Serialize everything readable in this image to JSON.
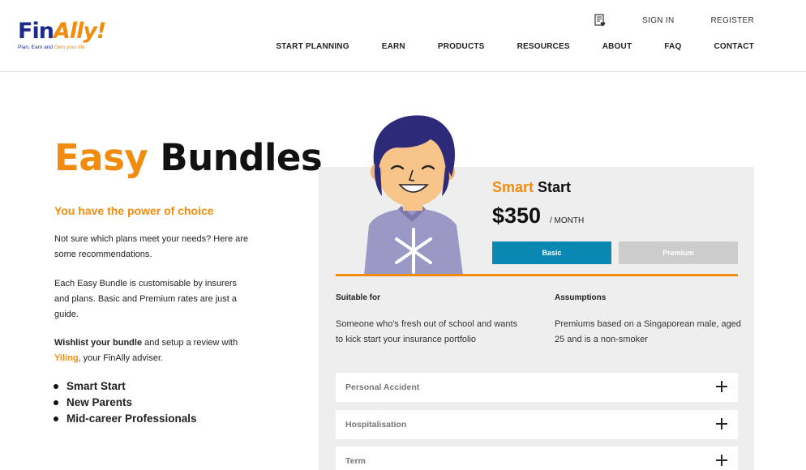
{
  "brand": {
    "logo_fin": "Fin",
    "logo_ally": "Ally!",
    "tagline_start": "Plan, Earn and ",
    "tagline_own": "Own your life",
    "navy": "#1d2b8f",
    "orange": "#f28c0f"
  },
  "header": {
    "wishlist_icon": "wishlist-icon",
    "sign_in": "SIGN IN",
    "register": "REGISTER",
    "nav": [
      "START PLANNING",
      "EARN",
      "PRODUCTS",
      "RESOURCES",
      "ABOUT",
      "FAQ",
      "CONTACT"
    ]
  },
  "hero": {
    "title_accent": "Easy",
    "title_main": " Bundles",
    "subtitle": "You have the power of choice",
    "para1": "Not sure which plans meet your needs? Here are some recommendations.",
    "para2": "Each Easy Bundle is customisable by insurers and plans. Basic and Premium rates are just a guide.",
    "para3_bold": "Wishlist your bundle",
    "para3_mid": " and setup a review with ",
    "adviser_name": "Yiling",
    "para3_end": ", your FinAlly adviser.",
    "bundles": [
      "Smart Start",
      "New Parents",
      "Mid-career Professionals"
    ]
  },
  "card": {
    "plan_accent": "Smart",
    "plan_rest": " Start",
    "price": "$350",
    "per": "/ MONTH",
    "tier_basic": "Basic",
    "tier_premium": "Premium",
    "accent_blue": "#0a88b3",
    "suitable_heading": "Suitable for",
    "suitable_text": "Someone who's fresh out of school and wants to kick start your insurance portfolio",
    "assumptions_heading": "Assumptions",
    "assumptions_text": "Premiums based on a Singaporean male, aged 25 and is a non-smoker",
    "coverage": [
      "Personal Accident",
      "Hospitalisation",
      "Term"
    ]
  }
}
